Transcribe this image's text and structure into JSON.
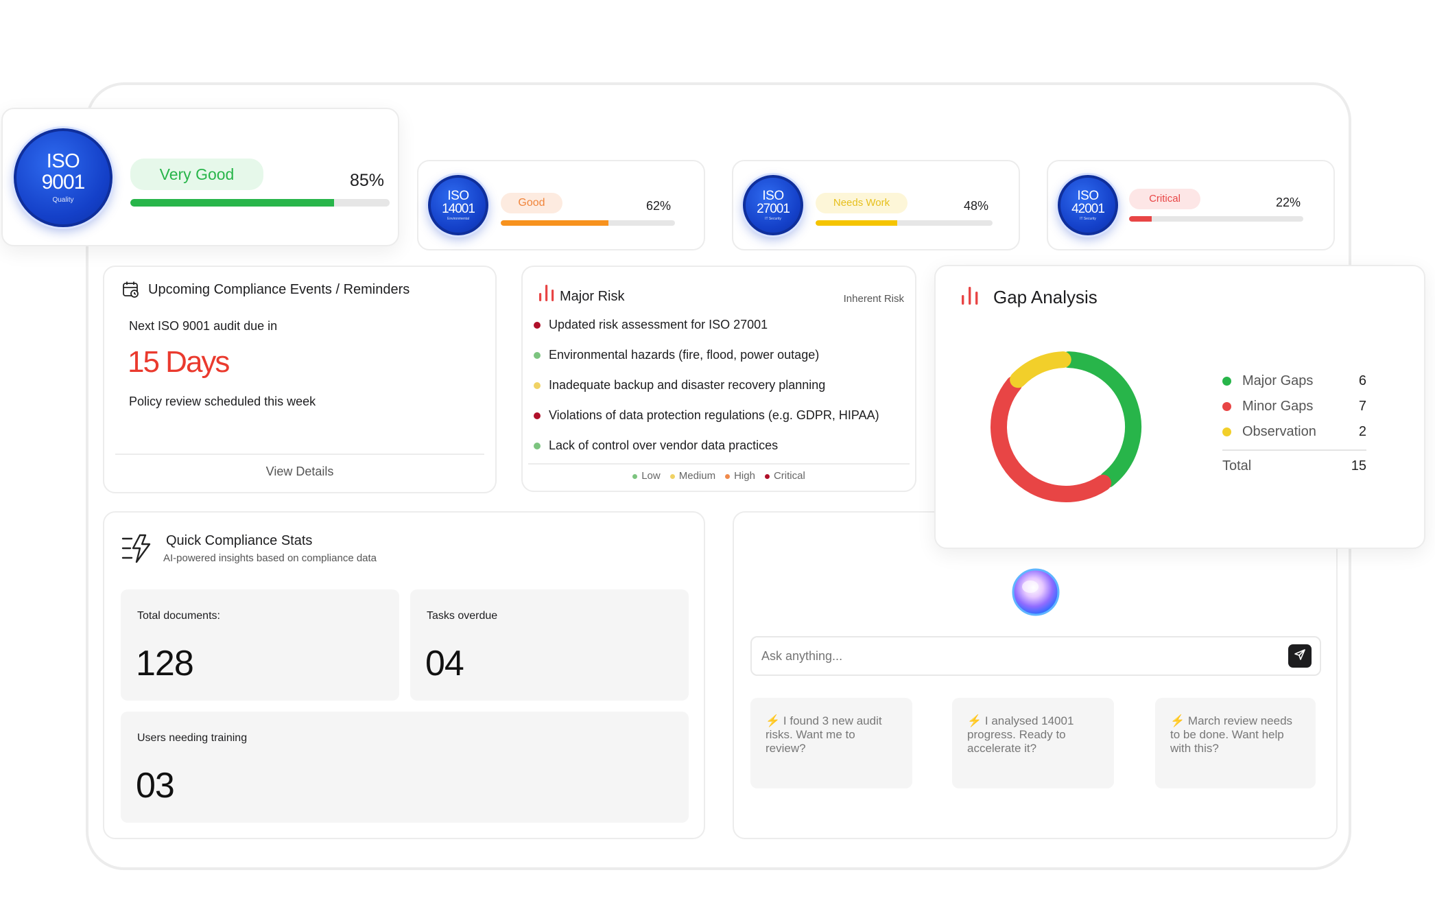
{
  "iso_cards": [
    {
      "iso": "ISO",
      "number": "9001",
      "sub": "Quality",
      "status": "Very Good",
      "percent": "85%",
      "progress": 0.785,
      "color": "#28b54a",
      "pill_bg": "#e6f8ea",
      "pill_fg": "#28b54a"
    },
    {
      "iso": "ISO",
      "number": "14001",
      "sub": "Environmental",
      "status": "Good",
      "percent": "62%",
      "progress": 0.62,
      "color": "#f7921e",
      "pill_bg": "#fdebe0",
      "pill_fg": "#f0843a"
    },
    {
      "iso": "ISO",
      "number": "27001",
      "sub": "IT Security",
      "status": "Needs Work",
      "percent": "48%",
      "progress": 0.46,
      "color": "#f5c400",
      "pill_bg": "#fdf6d8",
      "pill_fg": "#e6bf1c"
    },
    {
      "iso": "ISO",
      "number": "42001",
      "sub": "IT Security",
      "status": "Critical",
      "percent": "22%",
      "progress": 0.13,
      "color": "#e84545",
      "pill_bg": "#fde6e6",
      "pill_fg": "#e84545"
    }
  ],
  "events": {
    "title": "Upcoming Compliance Events / Reminders",
    "audit_text": "Next ISO 9001 audit due in",
    "days": "15 Days",
    "policy_text": "Policy review scheduled this week",
    "view_details": "View Details"
  },
  "major_risk": {
    "title": "Major Risk",
    "subtitle": "Inherent Risk",
    "items": [
      {
        "text": "Updated risk assessment for ISO 27001",
        "level": "critical",
        "color": "#b0102a"
      },
      {
        "text": "Environmental hazards (fire, flood, power outage)",
        "level": "low",
        "color": "#7cc47f"
      },
      {
        "text": "Inadequate backup and disaster recovery planning",
        "level": "medium",
        "color": "#f0d264"
      },
      {
        "text": "Violations of data protection regulations (e.g. GDPR, HIPAA)",
        "level": "critical",
        "color": "#b0102a"
      },
      {
        "text": "Lack of control over vendor data practices",
        "level": "low",
        "color": "#7cc47f"
      }
    ],
    "legend": [
      {
        "label": "Low",
        "color": "#7cc47f"
      },
      {
        "label": "Medium",
        "color": "#f0d264"
      },
      {
        "label": "High",
        "color": "#f08a4b"
      },
      {
        "label": "Critical",
        "color": "#b0102a"
      }
    ]
  },
  "gap_analysis": {
    "title": "Gap Analysis",
    "items": [
      {
        "label": "Major Gaps",
        "value": 6,
        "color": "#28b54a"
      },
      {
        "label": "Minor Gaps",
        "value": 7,
        "color": "#e84545"
      },
      {
        "label": "Observation",
        "value": 2,
        "color": "#f2cf2a"
      }
    ],
    "total_label": "Total",
    "total_value": "15"
  },
  "quick_stats": {
    "title": "Quick Compliance Stats",
    "subtitle": "AI-powered insights based on compliance data",
    "total_documents_label": "Total documents:",
    "total_documents": "128",
    "tasks_overdue_label": "Tasks overdue",
    "tasks_overdue": "04",
    "users_training_label": "Users needing training",
    "users_training": "03"
  },
  "assistant": {
    "placeholder": "Ask anything...",
    "suggestions": [
      "I found 3 new audit risks. Want me to review?",
      "I analysed 14001 progress. Ready to accelerate it?",
      "March review needs to be done. Want help with this?"
    ]
  },
  "icons": [
    "calendar-icon",
    "bar-chart-icon",
    "ai-stats-icon",
    "send-icon",
    "bolt-icon",
    "ai-orb-icon"
  ]
}
